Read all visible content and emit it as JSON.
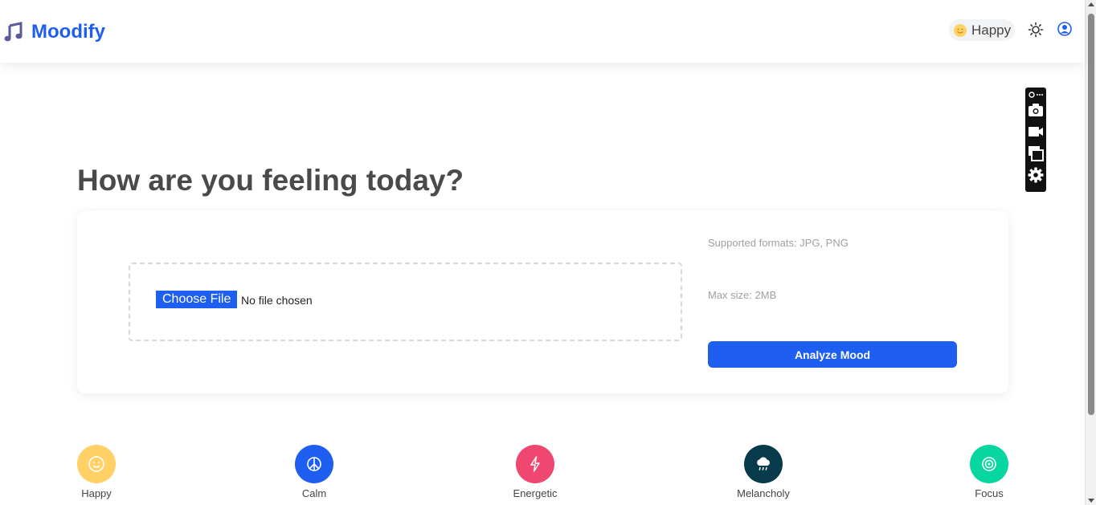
{
  "app": {
    "name": "Moodify"
  },
  "header": {
    "current_mood": "Happy",
    "icons": [
      "music-note-icon",
      "smile-icon",
      "sun-icon",
      "user-icon"
    ]
  },
  "toolbar": {
    "icons": [
      "link-icon",
      "more-icon",
      "camera-icon",
      "video-icon",
      "window-icon",
      "settings-icon"
    ]
  },
  "main": {
    "title": "How are you feeling today?",
    "upload": {
      "choose_label": "Choose File",
      "file_status": "No file chosen",
      "formats_hint": "Supported formats: JPG, PNG",
      "size_hint": "Max size: 2MB",
      "analyze_label": "Analyze Mood"
    }
  },
  "moods": [
    {
      "label": "Happy",
      "icon": "smile-icon",
      "color": "#ffd166"
    },
    {
      "label": "Calm",
      "icon": "peace-icon",
      "color": "#1e5ef0"
    },
    {
      "label": "Energetic",
      "icon": "lightning-icon",
      "color": "#ef476f"
    },
    {
      "label": "Melancholy",
      "icon": "rain-cloud-icon",
      "color": "#073b4c"
    },
    {
      "label": "Focus",
      "icon": "target-icon",
      "color": "#06d6a0"
    }
  ],
  "colors": {
    "brand": "#1e5ef0",
    "title": "#4a4a4a"
  }
}
